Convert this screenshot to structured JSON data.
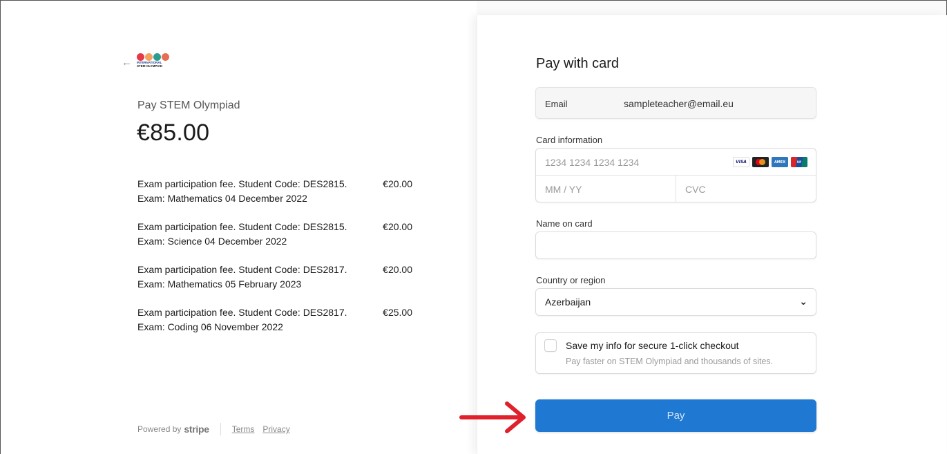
{
  "left": {
    "back_icon": "arrow-left-icon",
    "logo": {
      "alt_text_line1": "INTERNATIONAL",
      "alt_text_line2": "STEM OLYMPIAD",
      "colors": [
        "#e63946",
        "#f4a261",
        "#2a9d8f",
        "#e76f51"
      ]
    },
    "product_name": "Pay STEM Olympiad",
    "total": "€85.00",
    "items": [
      {
        "line1": "Exam participation fee. Student Code: DES2815.",
        "line2": "Exam: Mathematics 04 December 2022",
        "price": "€20.00"
      },
      {
        "line1": "Exam participation fee. Student Code: DES2815.",
        "line2": "Exam: Science 04 December 2022",
        "price": "€20.00"
      },
      {
        "line1": "Exam participation fee. Student Code: DES2817.",
        "line2": "Exam: Mathematics 05 February 2023",
        "price": "€20.00"
      },
      {
        "line1": "Exam participation fee. Student Code: DES2817.",
        "line2": "Exam: Coding 06 November 2022",
        "price": "€25.00"
      }
    ],
    "footer": {
      "powered_by": "Powered by",
      "brand": "stripe",
      "terms": "Terms",
      "privacy": "Privacy"
    }
  },
  "right": {
    "title": "Pay with card",
    "email_label": "Email",
    "email_value": "sampleteacher@email.eu",
    "card_label": "Card information",
    "card_number_placeholder": "1234 1234 1234 1234",
    "expiry_placeholder": "MM / YY",
    "cvc_placeholder": "CVC",
    "card_brands": [
      "VISA",
      "Mastercard",
      "American Express",
      "UnionPay"
    ],
    "name_label": "Name on card",
    "name_value": "",
    "country_label": "Country or region",
    "country_value": "Azerbaijan",
    "save_title": "Save my info for secure 1-click checkout",
    "save_subtitle": "Pay faster on STEM Olympiad and thousands of sites.",
    "pay_label": "Pay"
  },
  "annotation": {
    "arrow_color": "#e0202a"
  }
}
